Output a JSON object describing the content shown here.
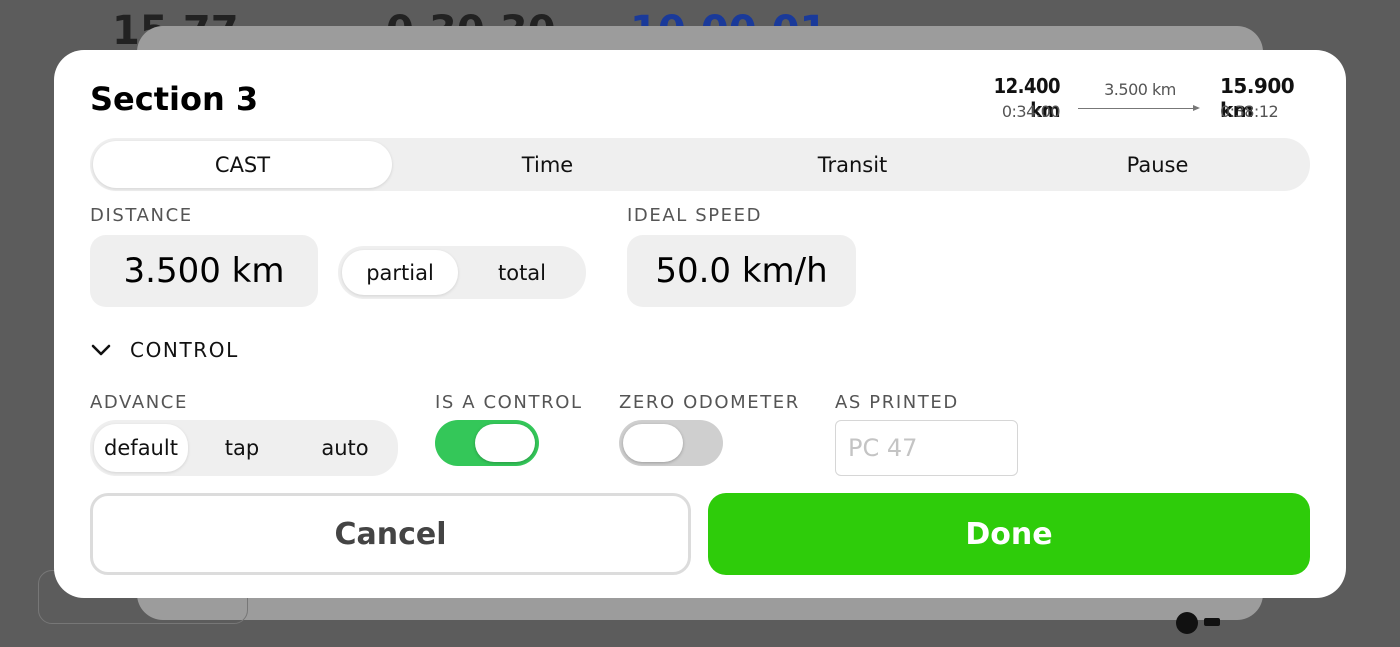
{
  "background": {
    "numbers": [
      "15.77",
      "0.30.30",
      "10.00.01"
    ]
  },
  "section": {
    "title": "Section 3",
    "route": {
      "from_distance": "12.400 km",
      "from_time": "0:34:00",
      "segment_distance": "3.500 km",
      "to_distance": "15.900 km",
      "to_time": "0:38:12"
    }
  },
  "tabs": [
    {
      "label": "CAST",
      "active": true
    },
    {
      "label": "Time",
      "active": false
    },
    {
      "label": "Transit",
      "active": false
    },
    {
      "label": "Pause",
      "active": false
    }
  ],
  "distance": {
    "label": "DISTANCE",
    "value": "3.500 km",
    "mode_options": [
      {
        "label": "partial",
        "active": true
      },
      {
        "label": "total",
        "active": false
      }
    ]
  },
  "ideal_speed": {
    "label": "IDEAL SPEED",
    "value": "50.0 km/h"
  },
  "control": {
    "label": "CONTROL",
    "advance": {
      "label": "ADVANCE",
      "options": [
        {
          "label": "default",
          "active": true
        },
        {
          "label": "tap",
          "active": false
        },
        {
          "label": "auto",
          "active": false
        }
      ]
    },
    "is_a_control": {
      "label": "IS A CONTROL",
      "on": true
    },
    "zero_odometer": {
      "label": "ZERO ODOMETER",
      "on": false
    },
    "as_printed": {
      "label": "AS PRINTED",
      "value": "",
      "placeholder": "PC 47"
    }
  },
  "buttons": {
    "cancel": "Cancel",
    "done": "Done"
  },
  "colors": {
    "accent_green": "#2ecc0a",
    "toggle_on": "#34c759",
    "toggle_off": "#cfcfcf"
  }
}
